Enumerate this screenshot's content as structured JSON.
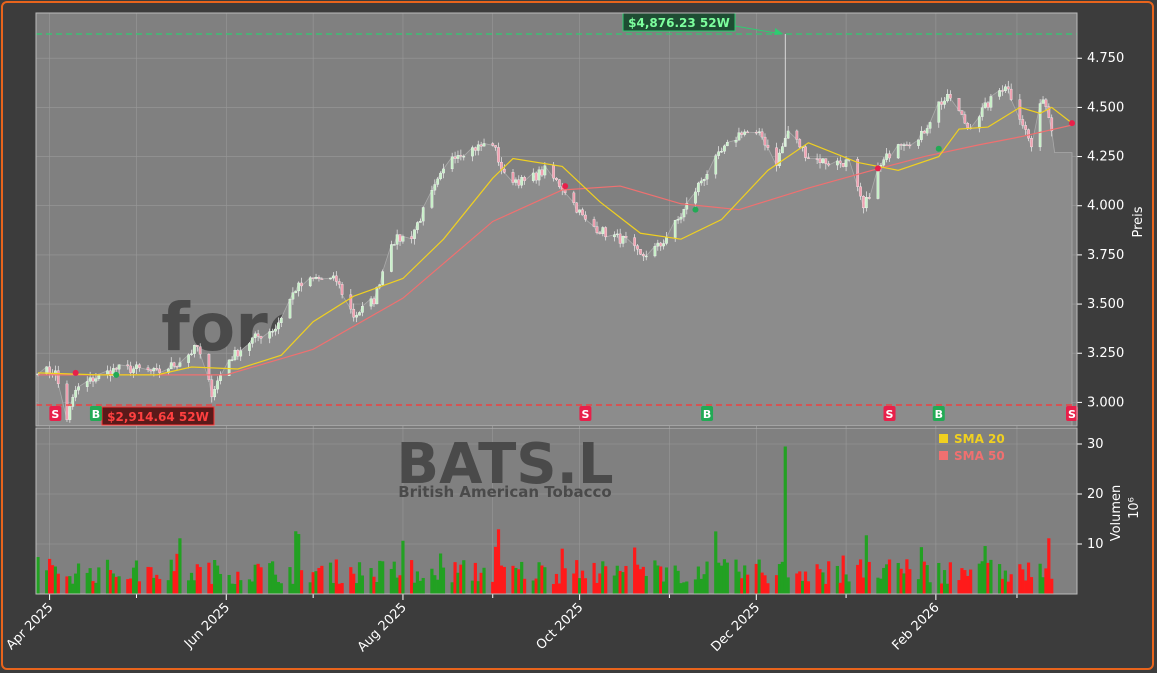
{
  "colors": {
    "background": "#3c3c3c",
    "panel": "#808080",
    "frame": "#e8641c",
    "up": "#22a122",
    "down": "#ff1a1a",
    "sma20": "#f0d020",
    "sma50": "#f07070",
    "high_line": "#2ecc71",
    "low_line": "#ff3333",
    "buy": "#22aa55",
    "sell": "#e8204a"
  },
  "chart_data": [
    {
      "type": "line",
      "title": "",
      "ylabel": "Preis",
      "ylim": [
        2.88,
        4.98
      ],
      "y_ticks": [
        "3.000",
        "3.250",
        "3.500",
        "3.750",
        "4.000",
        "4.250",
        "4.500",
        "4.750"
      ],
      "x_ticks": [
        "Apr 2025",
        "Jun 2025",
        "Aug 2025",
        "Oct 2025",
        "Dec 2025",
        "Feb 2026"
      ],
      "x_range": [
        "2025-03-28",
        "2026-03-20"
      ],
      "series": [
        {
          "name": "SMA 20",
          "color": "#f0d020"
        },
        {
          "name": "SMA 50",
          "color": "#f07070"
        }
      ],
      "price_series": [
        [
          "2025-03-28",
          3.17
        ],
        [
          "2025-04-03",
          3.15
        ],
        [
          "2025-04-07",
          2.92
        ],
        [
          "2025-04-10",
          3.06
        ],
        [
          "2025-04-16",
          3.12
        ],
        [
          "2025-04-24",
          3.17
        ],
        [
          "2025-05-01",
          3.17
        ],
        [
          "2025-05-08",
          3.15
        ],
        [
          "2025-05-15",
          3.2
        ],
        [
          "2025-05-22",
          3.28
        ],
        [
          "2025-05-27",
          3.05
        ],
        [
          "2025-06-02",
          3.22
        ],
        [
          "2025-06-10",
          3.32
        ],
        [
          "2025-06-18",
          3.38
        ],
        [
          "2025-06-25",
          3.58
        ],
        [
          "2025-07-02",
          3.63
        ],
        [
          "2025-07-09",
          3.62
        ],
        [
          "2025-07-15",
          3.44
        ],
        [
          "2025-07-22",
          3.52
        ],
        [
          "2025-07-28",
          3.82
        ],
        [
          "2025-08-04",
          3.85
        ],
        [
          "2025-08-11",
          4.06
        ],
        [
          "2025-08-18",
          4.26
        ],
        [
          "2025-08-25",
          4.29
        ],
        [
          "2025-09-01",
          4.32
        ],
        [
          "2025-09-05",
          4.15
        ],
        [
          "2025-09-12",
          4.12
        ],
        [
          "2025-09-19",
          4.18
        ],
        [
          "2025-09-26",
          4.08
        ],
        [
          "2025-10-03",
          3.92
        ],
        [
          "2025-10-10",
          3.86
        ],
        [
          "2025-10-17",
          3.82
        ],
        [
          "2025-10-22",
          3.74
        ],
        [
          "2025-10-29",
          3.8
        ],
        [
          "2025-11-05",
          3.95
        ],
        [
          "2025-11-12",
          4.13
        ],
        [
          "2025-11-19",
          4.27
        ],
        [
          "2025-11-26",
          4.38
        ],
        [
          "2025-12-03",
          4.35
        ],
        [
          "2025-12-08",
          4.22
        ],
        [
          "2025-12-12",
          4.38
        ],
        [
          "2025-12-19",
          4.25
        ],
        [
          "2025-12-26",
          4.22
        ],
        [
          "2026-01-02",
          4.22
        ],
        [
          "2026-01-07",
          3.98
        ],
        [
          "2026-01-12",
          4.18
        ],
        [
          "2026-01-19",
          4.33
        ],
        [
          "2026-01-26",
          4.33
        ],
        [
          "2026-02-02",
          4.52
        ],
        [
          "2026-02-06",
          4.55
        ],
        [
          "2026-02-12",
          4.4
        ],
        [
          "2026-02-18",
          4.5
        ],
        [
          "2026-02-25",
          4.62
        ],
        [
          "2026-03-02",
          4.46
        ],
        [
          "2026-03-06",
          4.3
        ],
        [
          "2026-03-10",
          4.56
        ],
        [
          "2026-03-16",
          4.25
        ],
        [
          "2026-03-20",
          4.25
        ]
      ],
      "sma20": [
        [
          "2025-03-28",
          3.15
        ],
        [
          "2025-04-18",
          3.14
        ],
        [
          "2025-05-08",
          3.14
        ],
        [
          "2025-05-20",
          3.18
        ],
        [
          "2025-06-05",
          3.17
        ],
        [
          "2025-06-20",
          3.24
        ],
        [
          "2025-07-01",
          3.41
        ],
        [
          "2025-07-15",
          3.54
        ],
        [
          "2025-08-01",
          3.63
        ],
        [
          "2025-08-15",
          3.83
        ],
        [
          "2025-09-01",
          4.14
        ],
        [
          "2025-09-08",
          4.24
        ],
        [
          "2025-09-25",
          4.2
        ],
        [
          "2025-10-08",
          4.02
        ],
        [
          "2025-10-22",
          3.86
        ],
        [
          "2025-11-05",
          3.83
        ],
        [
          "2025-11-19",
          3.93
        ],
        [
          "2025-12-05",
          4.18
        ],
        [
          "2025-12-19",
          4.32
        ],
        [
          "2026-01-05",
          4.22
        ],
        [
          "2026-01-19",
          4.18
        ],
        [
          "2026-02-02",
          4.25
        ],
        [
          "2026-02-09",
          4.39
        ],
        [
          "2026-02-19",
          4.4
        ],
        [
          "2026-03-02",
          4.5
        ],
        [
          "2026-03-09",
          4.47
        ],
        [
          "2026-03-13",
          4.5
        ],
        [
          "2026-03-20",
          4.42
        ]
      ],
      "sma50": [
        [
          "2025-03-28",
          3.14
        ],
        [
          "2025-05-01",
          3.14
        ],
        [
          "2025-06-01",
          3.14
        ],
        [
          "2025-07-01",
          3.27
        ],
        [
          "2025-08-01",
          3.53
        ],
        [
          "2025-09-01",
          3.92
        ],
        [
          "2025-09-25",
          4.08
        ],
        [
          "2025-10-15",
          4.1
        ],
        [
          "2025-11-05",
          4.01
        ],
        [
          "2025-11-25",
          3.98
        ],
        [
          "2025-12-19",
          4.09
        ],
        [
          "2026-01-10",
          4.18
        ],
        [
          "2026-01-28",
          4.25
        ],
        [
          "2026-02-16",
          4.31
        ],
        [
          "2026-03-02",
          4.35
        ],
        [
          "2026-03-20",
          4.41
        ]
      ],
      "high_52w": {
        "value": 4876.23,
        "label": "$4,876.23 52W",
        "date": "2025-12-11"
      },
      "low_52w": {
        "value": 2914.64,
        "label": "$2,914.64 52W",
        "date": "2025-04-07"
      },
      "signals": [
        {
          "label": "S",
          "date": "2025-04-03"
        },
        {
          "label": "B",
          "date": "2025-04-17"
        },
        {
          "label": "S",
          "date": "2025-10-03"
        },
        {
          "label": "B",
          "date": "2025-11-14"
        },
        {
          "label": "S",
          "date": "2026-01-16"
        },
        {
          "label": "B",
          "date": "2026-02-02"
        },
        {
          "label": "S",
          "date": "2026-03-20"
        }
      ]
    },
    {
      "type": "bar",
      "ylabel": "Volumen",
      "y_exponent": "10⁶",
      "ylim": [
        0,
        30
      ],
      "y_ticks": [
        "10",
        "20",
        "30"
      ],
      "note": "daily volume in millions, green = up day, red = down day",
      "peak": {
        "date": "2025-12-11",
        "value": 29.5
      }
    }
  ],
  "legend": [
    {
      "label": "SMA 20",
      "color": "#f0d020"
    },
    {
      "label": "SMA 50",
      "color": "#f07070"
    }
  ],
  "watermark": {
    "main": "forexsignale.trade",
    "ticker": "BATS.L",
    "company": "British American Tobacco"
  }
}
